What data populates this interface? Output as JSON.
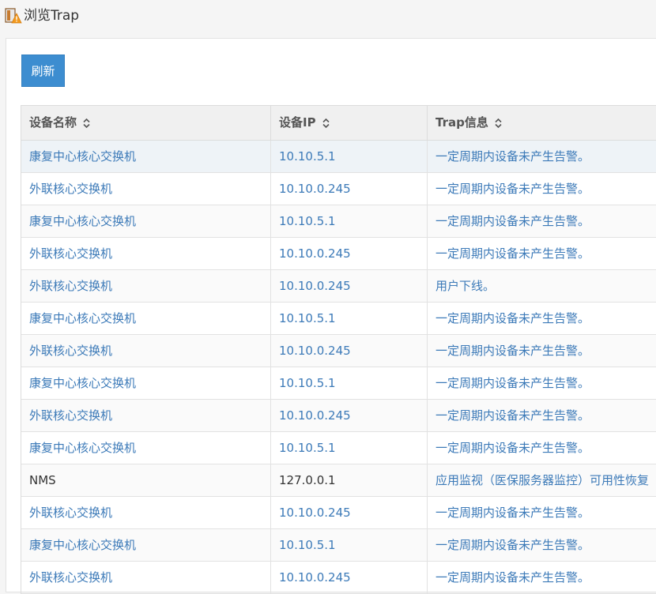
{
  "window": {
    "title": "浏览Trap",
    "icon": "trap-warning-icon"
  },
  "toolbar": {
    "refresh_label": "刷新"
  },
  "colors": {
    "accent": "#3d8dd0",
    "link": "#3c7ab8"
  },
  "table": {
    "columns": [
      {
        "label": "设备名称",
        "sortable": true
      },
      {
        "label": "设备IP",
        "sortable": true
      },
      {
        "label": "Trap信息",
        "sortable": true
      }
    ],
    "rows": [
      {
        "name": "康复中心核心交换机",
        "ip": "10.10.5.1",
        "info": "一定周期内设备未产生告警。",
        "link": true
      },
      {
        "name": "外联核心交换机",
        "ip": "10.10.0.245",
        "info": "一定周期内设备未产生告警。",
        "link": true
      },
      {
        "name": "康复中心核心交换机",
        "ip": "10.10.5.1",
        "info": "一定周期内设备未产生告警。",
        "link": true
      },
      {
        "name": "外联核心交换机",
        "ip": "10.10.0.245",
        "info": "一定周期内设备未产生告警。",
        "link": true
      },
      {
        "name": "外联核心交换机",
        "ip": "10.10.0.245",
        "info": "用户下线。",
        "link": true
      },
      {
        "name": "康复中心核心交换机",
        "ip": "10.10.5.1",
        "info": "一定周期内设备未产生告警。",
        "link": true
      },
      {
        "name": "外联核心交换机",
        "ip": "10.10.0.245",
        "info": "一定周期内设备未产生告警。",
        "link": true
      },
      {
        "name": "康复中心核心交换机",
        "ip": "10.10.5.1",
        "info": "一定周期内设备未产生告警。",
        "link": true
      },
      {
        "name": "外联核心交换机",
        "ip": "10.10.0.245",
        "info": "一定周期内设备未产生告警。",
        "link": true
      },
      {
        "name": "康复中心核心交换机",
        "ip": "10.10.5.1",
        "info": "一定周期内设备未产生告警。",
        "link": true
      },
      {
        "name": "NMS",
        "ip": "127.0.0.1",
        "info": "应用监视（医保服务器监控）可用性恢复",
        "link": false
      },
      {
        "name": "外联核心交换机",
        "ip": "10.10.0.245",
        "info": "一定周期内设备未产生告警。",
        "link": true
      },
      {
        "name": "康复中心核心交换机",
        "ip": "10.10.5.1",
        "info": "一定周期内设备未产生告警。",
        "link": true
      },
      {
        "name": "外联核心交换机",
        "ip": "10.10.0.245",
        "info": "一定周期内设备未产生告警。",
        "link": true
      }
    ]
  }
}
